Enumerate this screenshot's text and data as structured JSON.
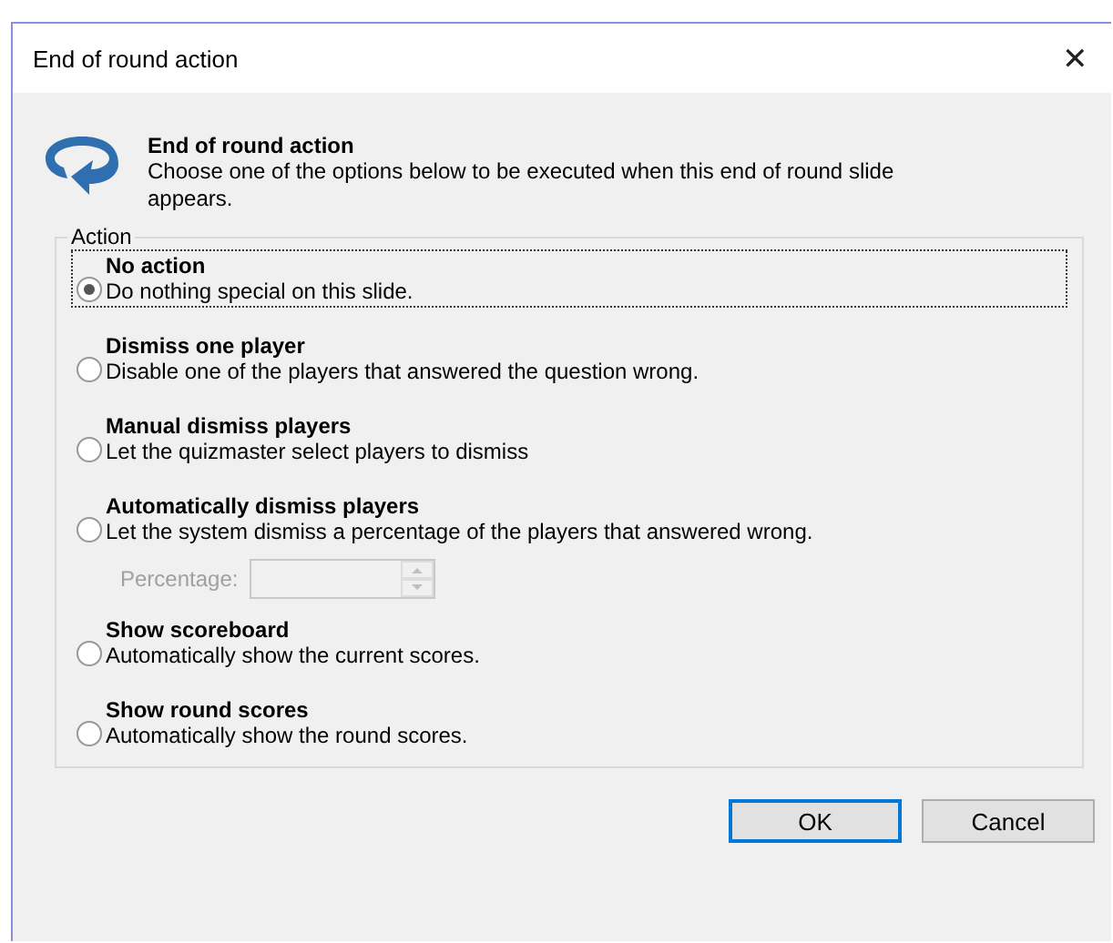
{
  "window": {
    "title": "End of round action",
    "close": "✕"
  },
  "header": {
    "title": "End of round action",
    "description": "Choose one of the options below to be executed when this end of round slide appears."
  },
  "group": {
    "label": "Action"
  },
  "options": [
    {
      "title": "No action",
      "description": "Do nothing special on this slide.",
      "selected": true
    },
    {
      "title": "Dismiss one player",
      "description": "Disable one of the players that answered the question wrong.",
      "selected": false
    },
    {
      "title": "Manual dismiss players",
      "description": "Let the quizmaster select players to dismiss",
      "selected": false
    },
    {
      "title": "Automatically dismiss players",
      "description": "Let the system dismiss a percentage of the players that answered wrong.",
      "selected": false,
      "percentage": {
        "label": "Percentage:",
        "disabled": true
      }
    },
    {
      "title": "Show scoreboard",
      "description": "Automatically show the current scores.",
      "selected": false
    },
    {
      "title": "Show round scores",
      "description": "Automatically show the round scores.",
      "selected": false
    }
  ],
  "buttons": [
    {
      "label": "OK",
      "default": true
    },
    {
      "label": "Cancel",
      "default": false
    }
  ]
}
